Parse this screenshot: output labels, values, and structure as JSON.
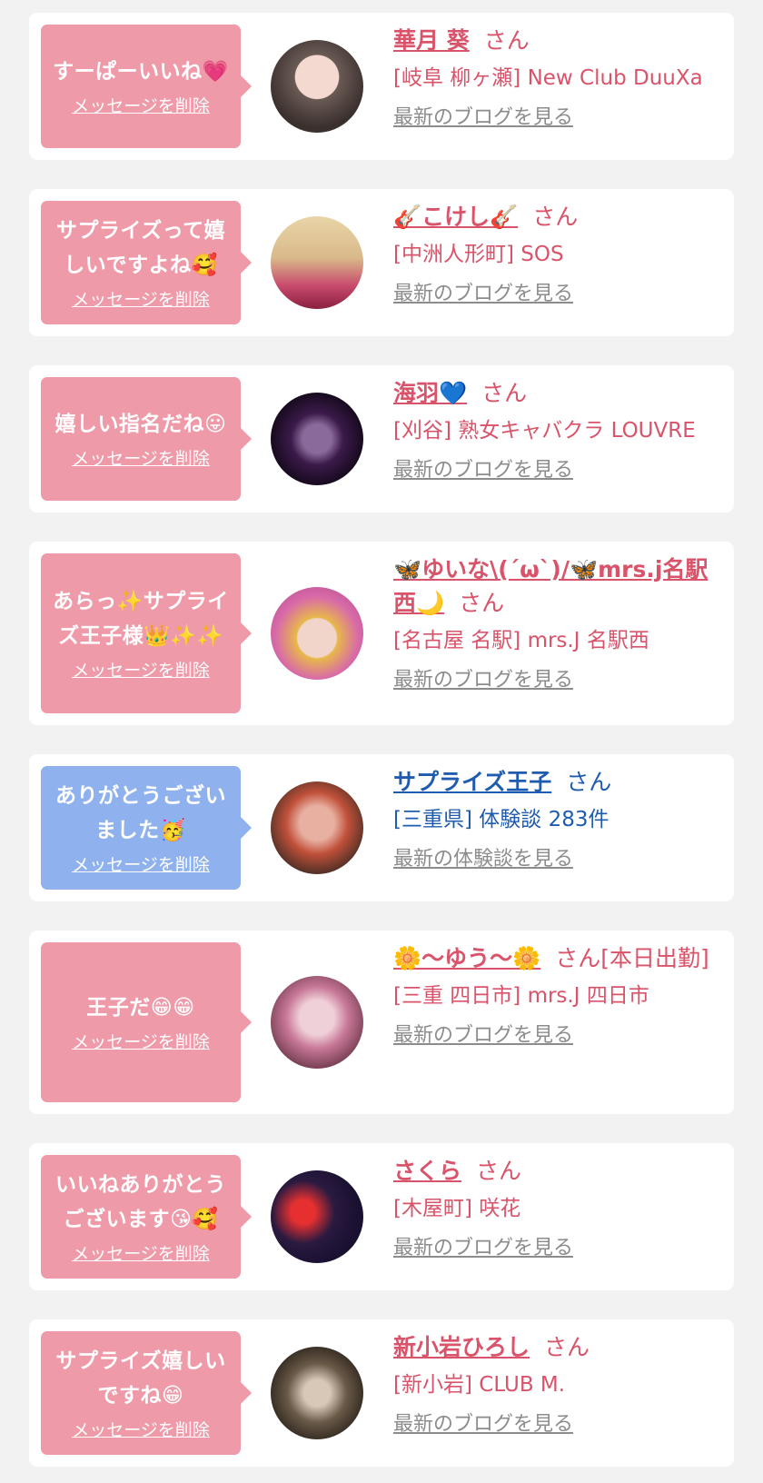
{
  "colors": {
    "background": "#f2f2f2",
    "pink_bubble": "#ef9aa8",
    "blue_bubble": "#8fb2ee",
    "pink_text": "#d9536a",
    "blue_text": "#1f5cb0",
    "link_gray": "#8c8c8c"
  },
  "delete_label": "メッセージを削除",
  "honorific": "さん",
  "items": [
    {
      "message": "すーぱーいいね💗",
      "name": "華月 葵",
      "suffix": "",
      "shop": "[岐阜 柳ヶ瀬] New Club DuuXa",
      "link": "最新のブログを見る",
      "theme": "pink"
    },
    {
      "message": "サプライズって嬉しいですよね🥰",
      "name": "🎸こけし🎸",
      "suffix": "",
      "shop": "[中洲人形町] SOS",
      "link": "最新のブログを見る",
      "theme": "pink"
    },
    {
      "message": "嬉しい指名だね😛",
      "name": "海羽💙",
      "suffix": "",
      "shop": "[刈谷] 熟女キャバクラ LOUVRE",
      "link": "最新のブログを見る",
      "theme": "pink"
    },
    {
      "message": "あらっ✨サプライズ王子様👑✨✨",
      "name": "🦋ゆいな\\(´ω`)/🦋mrs.j名駅西🌙",
      "suffix": "",
      "shop": "[名古屋 名駅] mrs.J 名駅西",
      "link": "最新のブログを見る",
      "theme": "pink"
    },
    {
      "message": "ありがとうございました🥳",
      "name": "サプライズ王子",
      "suffix": "",
      "shop": "[三重県] 体験談 283件",
      "link": "最新の体験談を見る",
      "theme": "blue"
    },
    {
      "message": "王子だ😁😁",
      "name": "🌼〜ゆう〜🌼",
      "suffix": "[本日出勤]",
      "shop": "[三重 四日市] mrs.J 四日市",
      "link": "最新のブログを見る",
      "theme": "pink"
    },
    {
      "message": "いいねありがとうございます😘🥰",
      "name": "さくら",
      "suffix": "",
      "shop": "[木屋町] 咲花",
      "link": "最新のブログを見る",
      "theme": "pink"
    },
    {
      "message": "サプライズ嬉しいですね😁",
      "name": "新小岩ひろし",
      "suffix": "",
      "shop": "[新小岩] CLUB M.",
      "link": "最新のブログを見る",
      "theme": "pink"
    }
  ]
}
